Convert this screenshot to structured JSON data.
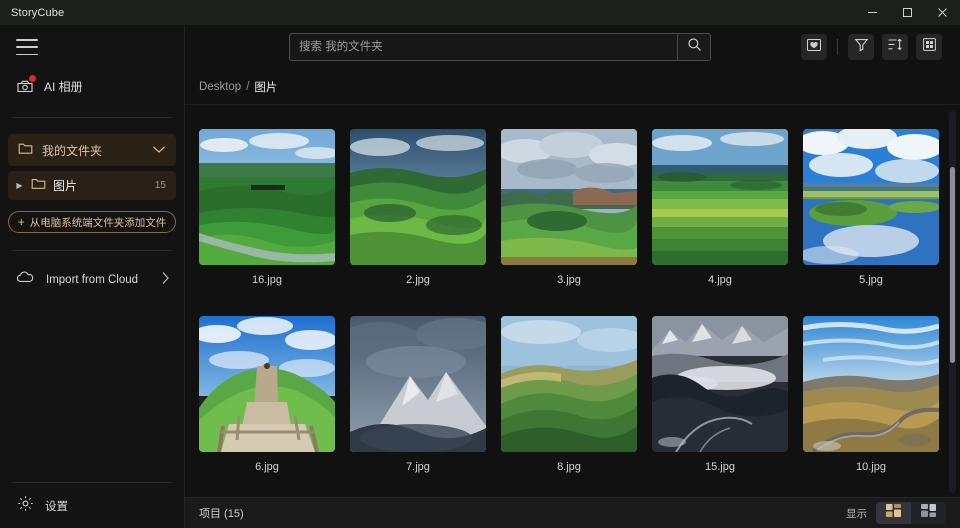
{
  "window": {
    "title": "StoryCube",
    "minimize_label": "minimize",
    "maximize_label": "maximize",
    "close_label": "close"
  },
  "sidebar": {
    "menu_icon": "hamburger-icon",
    "ai_album": {
      "label": "AI 相册",
      "icon": "ai-album-icon",
      "badge": true
    },
    "my_folder": {
      "label": "我的文件夹",
      "icon": "folder-icon",
      "chevron": "chevron-down-icon",
      "expanded": true
    },
    "pictures": {
      "label": "图片",
      "count": "15",
      "icon": "folder-icon",
      "caret": "caret-right-icon",
      "selected": true
    },
    "add_button": {
      "label": "从电脑系统端文件夹添加文件",
      "plus": "+"
    },
    "import_cloud": {
      "label": "Import from Cloud",
      "icon": "cloud-icon",
      "chevron": "chevron-right-icon"
    },
    "settings": {
      "label": "设置",
      "icon": "gear-icon"
    }
  },
  "toolbar": {
    "search": {
      "placeholder": "搜索 我的文件夹",
      "value": ""
    },
    "search_button": "search-icon",
    "icons": [
      {
        "name": "photo-favorite-icon",
        "title": ""
      },
      {
        "name": "filter-icon",
        "title": ""
      },
      {
        "name": "sort-icon",
        "title": ""
      },
      {
        "name": "grid-view-icon",
        "title": ""
      }
    ]
  },
  "breadcrumb": {
    "parent": "Desktop",
    "separator": "/",
    "current": "图片"
  },
  "gallery": {
    "items": [
      {
        "name": "16.jpg",
        "scene": "green-grassland-river"
      },
      {
        "name": "2.jpg",
        "scene": "rolling-green-hills"
      },
      {
        "name": "3.jpg",
        "scene": "cloudy-green-plain"
      },
      {
        "name": "4.jpg",
        "scene": "green-steppe-stripes"
      },
      {
        "name": "5.jpg",
        "scene": "wetland-reflection-sky"
      },
      {
        "name": "6.jpg",
        "scene": "wooden-boardwalk-hill"
      },
      {
        "name": "7.jpg",
        "scene": "snow-peak-clouds"
      },
      {
        "name": "8.jpg",
        "scene": "golden-green-slope"
      },
      {
        "name": "15.jpg",
        "scene": "dark-mountain-valley"
      },
      {
        "name": "10.jpg",
        "scene": "autumn-mountain-road"
      }
    ]
  },
  "statusbar": {
    "items_label": "项目 (15)",
    "display_label": "显示",
    "view_buttons": [
      {
        "name": "view-layout-a",
        "active": true
      },
      {
        "name": "view-layout-b",
        "active": false
      }
    ]
  },
  "colors": {
    "accent_gold": "#d9b887",
    "badge_red": "#f02121",
    "bg": "#111111",
    "sidebar_bg": "#131313",
    "titlebar_bg": "#1c1f1c"
  }
}
